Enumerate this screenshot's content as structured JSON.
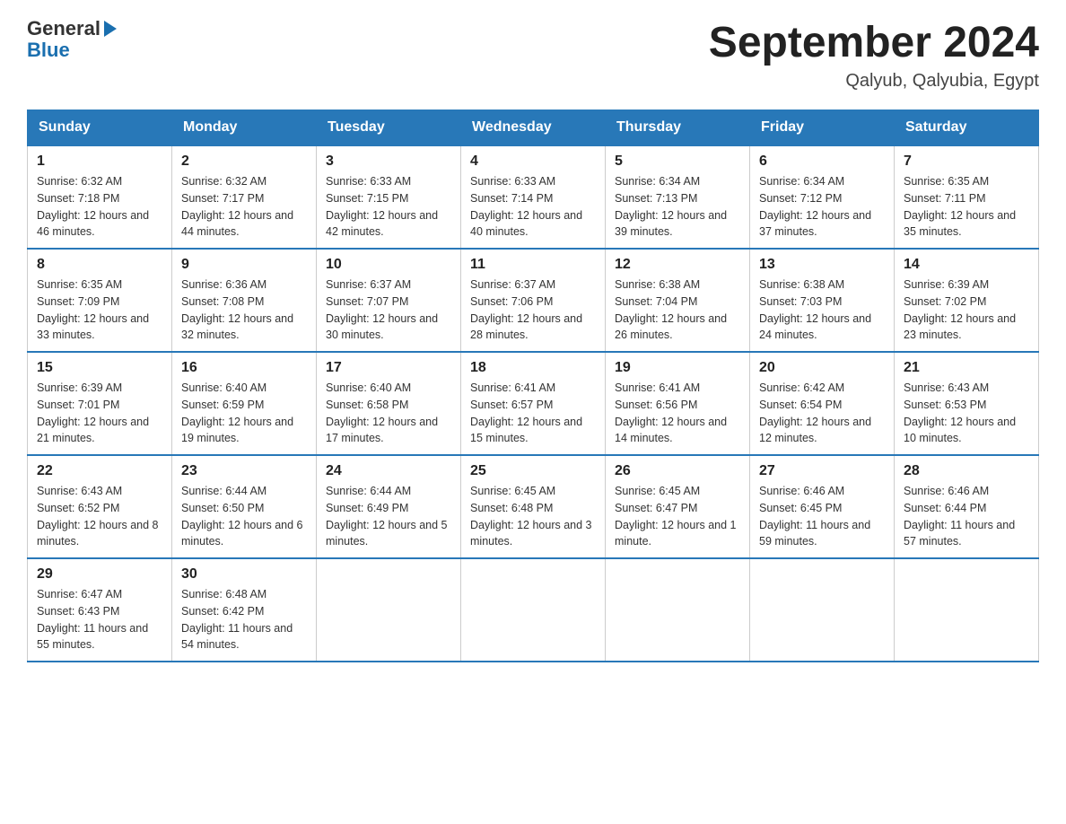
{
  "logo": {
    "text_general": "General",
    "text_blue": "Blue"
  },
  "header": {
    "month_year": "September 2024",
    "location": "Qalyub, Qalyubia, Egypt"
  },
  "days_of_week": [
    "Sunday",
    "Monday",
    "Tuesday",
    "Wednesday",
    "Thursday",
    "Friday",
    "Saturday"
  ],
  "weeks": [
    [
      {
        "day": "1",
        "sunrise": "6:32 AM",
        "sunset": "7:18 PM",
        "daylight": "12 hours and 46 minutes."
      },
      {
        "day": "2",
        "sunrise": "6:32 AM",
        "sunset": "7:17 PM",
        "daylight": "12 hours and 44 minutes."
      },
      {
        "day": "3",
        "sunrise": "6:33 AM",
        "sunset": "7:15 PM",
        "daylight": "12 hours and 42 minutes."
      },
      {
        "day": "4",
        "sunrise": "6:33 AM",
        "sunset": "7:14 PM",
        "daylight": "12 hours and 40 minutes."
      },
      {
        "day": "5",
        "sunrise": "6:34 AM",
        "sunset": "7:13 PM",
        "daylight": "12 hours and 39 minutes."
      },
      {
        "day": "6",
        "sunrise": "6:34 AM",
        "sunset": "7:12 PM",
        "daylight": "12 hours and 37 minutes."
      },
      {
        "day": "7",
        "sunrise": "6:35 AM",
        "sunset": "7:11 PM",
        "daylight": "12 hours and 35 minutes."
      }
    ],
    [
      {
        "day": "8",
        "sunrise": "6:35 AM",
        "sunset": "7:09 PM",
        "daylight": "12 hours and 33 minutes."
      },
      {
        "day": "9",
        "sunrise": "6:36 AM",
        "sunset": "7:08 PM",
        "daylight": "12 hours and 32 minutes."
      },
      {
        "day": "10",
        "sunrise": "6:37 AM",
        "sunset": "7:07 PM",
        "daylight": "12 hours and 30 minutes."
      },
      {
        "day": "11",
        "sunrise": "6:37 AM",
        "sunset": "7:06 PM",
        "daylight": "12 hours and 28 minutes."
      },
      {
        "day": "12",
        "sunrise": "6:38 AM",
        "sunset": "7:04 PM",
        "daylight": "12 hours and 26 minutes."
      },
      {
        "day": "13",
        "sunrise": "6:38 AM",
        "sunset": "7:03 PM",
        "daylight": "12 hours and 24 minutes."
      },
      {
        "day": "14",
        "sunrise": "6:39 AM",
        "sunset": "7:02 PM",
        "daylight": "12 hours and 23 minutes."
      }
    ],
    [
      {
        "day": "15",
        "sunrise": "6:39 AM",
        "sunset": "7:01 PM",
        "daylight": "12 hours and 21 minutes."
      },
      {
        "day": "16",
        "sunrise": "6:40 AM",
        "sunset": "6:59 PM",
        "daylight": "12 hours and 19 minutes."
      },
      {
        "day": "17",
        "sunrise": "6:40 AM",
        "sunset": "6:58 PM",
        "daylight": "12 hours and 17 minutes."
      },
      {
        "day": "18",
        "sunrise": "6:41 AM",
        "sunset": "6:57 PM",
        "daylight": "12 hours and 15 minutes."
      },
      {
        "day": "19",
        "sunrise": "6:41 AM",
        "sunset": "6:56 PM",
        "daylight": "12 hours and 14 minutes."
      },
      {
        "day": "20",
        "sunrise": "6:42 AM",
        "sunset": "6:54 PM",
        "daylight": "12 hours and 12 minutes."
      },
      {
        "day": "21",
        "sunrise": "6:43 AM",
        "sunset": "6:53 PM",
        "daylight": "12 hours and 10 minutes."
      }
    ],
    [
      {
        "day": "22",
        "sunrise": "6:43 AM",
        "sunset": "6:52 PM",
        "daylight": "12 hours and 8 minutes."
      },
      {
        "day": "23",
        "sunrise": "6:44 AM",
        "sunset": "6:50 PM",
        "daylight": "12 hours and 6 minutes."
      },
      {
        "day": "24",
        "sunrise": "6:44 AM",
        "sunset": "6:49 PM",
        "daylight": "12 hours and 5 minutes."
      },
      {
        "day": "25",
        "sunrise": "6:45 AM",
        "sunset": "6:48 PM",
        "daylight": "12 hours and 3 minutes."
      },
      {
        "day": "26",
        "sunrise": "6:45 AM",
        "sunset": "6:47 PM",
        "daylight": "12 hours and 1 minute."
      },
      {
        "day": "27",
        "sunrise": "6:46 AM",
        "sunset": "6:45 PM",
        "daylight": "11 hours and 59 minutes."
      },
      {
        "day": "28",
        "sunrise": "6:46 AM",
        "sunset": "6:44 PM",
        "daylight": "11 hours and 57 minutes."
      }
    ],
    [
      {
        "day": "29",
        "sunrise": "6:47 AM",
        "sunset": "6:43 PM",
        "daylight": "11 hours and 55 minutes."
      },
      {
        "day": "30",
        "sunrise": "6:48 AM",
        "sunset": "6:42 PM",
        "daylight": "11 hours and 54 minutes."
      },
      null,
      null,
      null,
      null,
      null
    ]
  ]
}
